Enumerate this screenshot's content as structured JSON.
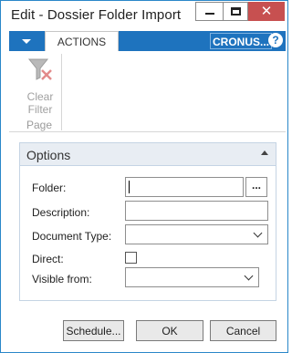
{
  "window": {
    "title": "Edit - Dossier Folder Import",
    "minimize_glyph": "",
    "close_glyph": "✕"
  },
  "ribbon": {
    "tab_label": "ACTIONS",
    "company": "CRONUS...",
    "help_glyph": "?",
    "group_label": "Page",
    "clear_filter": {
      "line1": "Clear",
      "line2": "Filter",
      "icon": "clear-filter-icon",
      "enabled": false
    }
  },
  "options": {
    "title": "Options",
    "expanded": true,
    "fields": {
      "folder": {
        "label": "Folder:",
        "value": "",
        "assist_label": "..."
      },
      "description": {
        "label": "Description:",
        "value": ""
      },
      "document_type": {
        "label": "Document Type:",
        "value": ""
      },
      "direct": {
        "label": "Direct:",
        "checked": false
      },
      "visible_from": {
        "label": "Visible from:",
        "value": ""
      }
    }
  },
  "buttons": {
    "schedule": "Schedule...",
    "ok": "OK",
    "cancel": "Cancel"
  },
  "colors": {
    "ribbon_blue": "#1e73be",
    "close_red": "#c75050",
    "options_header": "#e8edf3"
  }
}
